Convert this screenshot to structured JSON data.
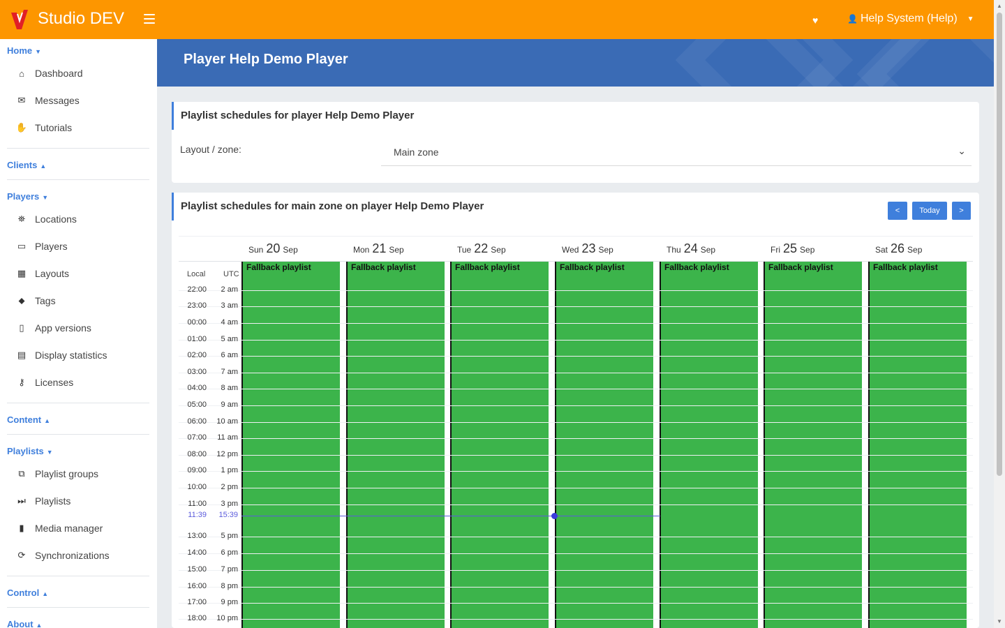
{
  "app": {
    "brand": "Studio DEV",
    "accent": "#fd9600",
    "link": "#3f7fdc"
  },
  "topbar": {
    "user": "Help System (Help)"
  },
  "sidebar": {
    "home": {
      "title": "Home",
      "items": [
        {
          "label": "Dashboard",
          "icon": "home-icon"
        },
        {
          "label": "Messages",
          "icon": "envelope-icon"
        },
        {
          "label": "Tutorials",
          "icon": "handshake-icon"
        }
      ]
    },
    "clients": {
      "title": "Clients"
    },
    "players": {
      "title": "Players",
      "items": [
        {
          "label": "Locations",
          "icon": "map-icon"
        },
        {
          "label": "Players",
          "icon": "monitor-icon"
        },
        {
          "label": "Layouts",
          "icon": "grid-icon"
        },
        {
          "label": "Tags",
          "icon": "tag-icon"
        },
        {
          "label": "App versions",
          "icon": "mobile-icon"
        },
        {
          "label": "Display statistics",
          "icon": "calculator-icon"
        },
        {
          "label": "Licenses",
          "icon": "key-icon"
        }
      ]
    },
    "content": {
      "title": "Content"
    },
    "playlists": {
      "title": "Playlists",
      "items": [
        {
          "label": "Playlist groups",
          "icon": "object-group-icon"
        },
        {
          "label": "Playlists",
          "icon": "fast-forward-icon"
        },
        {
          "label": "Media manager",
          "icon": "file-icon"
        },
        {
          "label": "Synchronizations",
          "icon": "sync-icon"
        }
      ]
    },
    "control": {
      "title": "Control"
    },
    "about": {
      "title": "About"
    }
  },
  "banner": {
    "title": "Player Help Demo Player"
  },
  "schedules_panel": {
    "title": "Playlist schedules for player Help Demo Player",
    "zone_label": "Layout / zone:",
    "zone_value": "Main zone"
  },
  "calendar_panel": {
    "title": "Playlist schedules for main zone on player Help Demo Player",
    "prev": "<",
    "today": "Today",
    "next": ">",
    "col_local": "Local",
    "col_utc": "UTC",
    "days": [
      {
        "dow": "Sun",
        "num": "20",
        "mon": "Sep",
        "event": "Fallback playlist"
      },
      {
        "dow": "Mon",
        "num": "21",
        "mon": "Sep",
        "event": "Fallback playlist"
      },
      {
        "dow": "Tue",
        "num": "22",
        "mon": "Sep",
        "event": "Fallback playlist"
      },
      {
        "dow": "Wed",
        "num": "23",
        "mon": "Sep",
        "event": "Fallback playlist"
      },
      {
        "dow": "Thu",
        "num": "24",
        "mon": "Sep",
        "event": "Fallback playlist"
      },
      {
        "dow": "Fri",
        "num": "25",
        "mon": "Sep",
        "event": "Fallback playlist"
      },
      {
        "dow": "Sat",
        "num": "26",
        "mon": "Sep",
        "event": "Fallback playlist"
      }
    ],
    "times": [
      {
        "local": "22:00",
        "utc": "2 am"
      },
      {
        "local": "23:00",
        "utc": "3 am"
      },
      {
        "local": "00:00",
        "utc": "4 am"
      },
      {
        "local": "01:00",
        "utc": "5 am"
      },
      {
        "local": "02:00",
        "utc": "6 am"
      },
      {
        "local": "03:00",
        "utc": "7 am"
      },
      {
        "local": "04:00",
        "utc": "8 am"
      },
      {
        "local": "05:00",
        "utc": "9 am"
      },
      {
        "local": "06:00",
        "utc": "10 am"
      },
      {
        "local": "07:00",
        "utc": "11 am"
      },
      {
        "local": "08:00",
        "utc": "12 pm"
      },
      {
        "local": "09:00",
        "utc": "1 pm"
      },
      {
        "local": "10:00",
        "utc": "2 pm"
      },
      {
        "local": "11:00",
        "utc": "3 pm"
      },
      {
        "local": "11:39",
        "utc": "15:39",
        "now": true
      },
      {
        "local": "13:00",
        "utc": "5 pm"
      },
      {
        "local": "14:00",
        "utc": "6 pm"
      },
      {
        "local": "15:00",
        "utc": "7 pm"
      },
      {
        "local": "16:00",
        "utc": "8 pm"
      },
      {
        "local": "17:00",
        "utc": "9 pm"
      },
      {
        "local": "18:00",
        "utc": "10 pm"
      }
    ],
    "event_color": "#3cb44b",
    "now_color": "#5b5bdc"
  }
}
